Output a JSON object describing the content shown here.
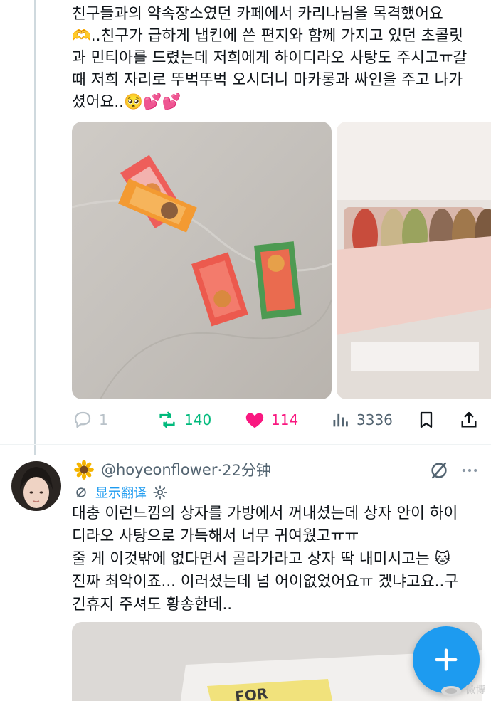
{
  "post1": {
    "text": "친구들과의 약속장소였던 카페에서 카리나님을 목격했어요\n🫶..친구가 급하게 냅킨에 쓴 편지와 함께 가지고 있던 초콜릿\n과 민티아를 드렸는데 저희에게 하이디라오 사탕도 주시고ㅠ갈\n때 저희 자리로 뚜벅뚜벅 오시더니 마카롱과 싸인을 주고 나가\n셨어요..🥺💕💕",
    "stats": {
      "replies": "1",
      "retweets": "140",
      "likes": "114",
      "views": "3336"
    },
    "icons": {
      "reply": "reply-icon",
      "retweet": "retweet-icon",
      "like": "heart-icon",
      "views": "views-icon",
      "bookmark": "bookmark-icon",
      "share": "share-icon"
    }
  },
  "post2": {
    "handle": "@hoyeonflower",
    "time": "·22分钟",
    "translate_label": "显示翻译",
    "text": "대충 이런느낌의 상자를 가방에서 꺼내셨는데 상자 안이 하이\n디라오 사탕으로 가득해서 너무 귀여웠고ㅠㅠ\n줄 게 이것밖에 없다면서 골라가라고 상자 딱 내미시고는 🐱\n진짜 최악이죠... 이러셨는데 넘 어이없었어요ㅠ 겠냐고요..구\n긴휴지 주셔도 황송한데..",
    "media_text": "FOR"
  },
  "watermark": "微博",
  "colors": {
    "accent": "#1d9bf0",
    "retweet": "#00ba7c",
    "like": "#f91880",
    "muted": "#536471"
  }
}
